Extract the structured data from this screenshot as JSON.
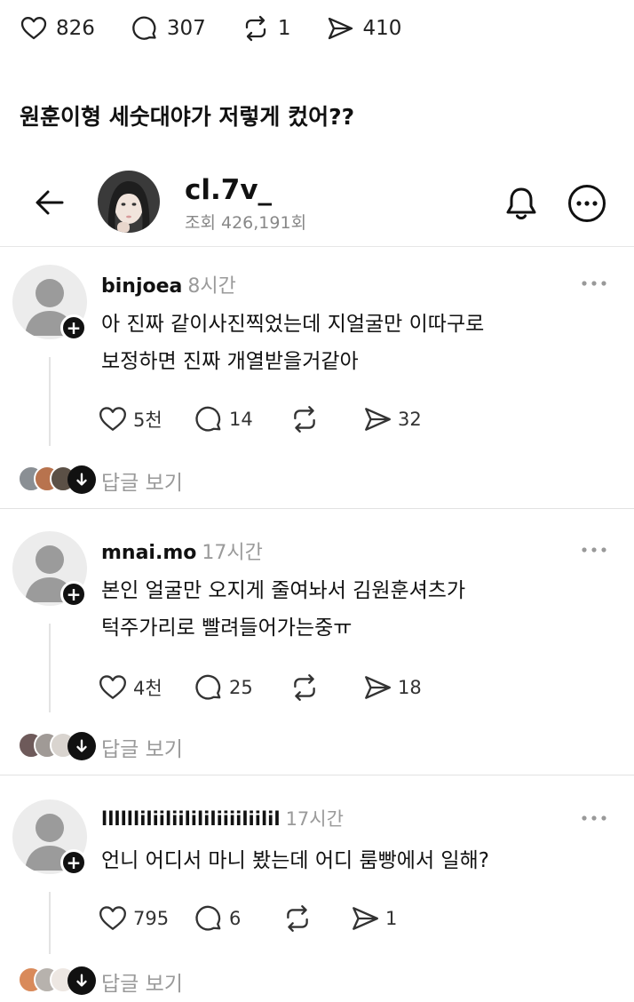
{
  "top_actions": {
    "likes": "826",
    "comments": "307",
    "reposts": "1",
    "shares": "410"
  },
  "caption": "원훈이형 세숫대야가 저렇게 컸어??",
  "header": {
    "username": "cl.7v_",
    "views": "조회 426,191회"
  },
  "comments": [
    {
      "user": "binjoea",
      "time": "8시간",
      "lines": [
        "아 진짜 같이사진찍었는데 지얼굴만 이따구로",
        "보정하면 진짜 개열받을거같아"
      ],
      "likes": "5천",
      "replies": "14",
      "shares": "32",
      "view_replies": "답글 보기"
    },
    {
      "user": "mnai.mo",
      "time": "17시간",
      "lines": [
        "본인 얼굴만 오지게 줄여놔서 김원훈셔츠가",
        "턱주가리로 빨려들어가는중ㅠ"
      ],
      "likes": "4천",
      "replies": "25",
      "shares": "18",
      "view_replies": "답글 보기"
    },
    {
      "user": "lllllliliiliilililiiiiliilil",
      "time": "17시간",
      "lines": [
        "언니 어디서 마니 봤는데 어디 룸빵에서 일해?"
      ],
      "likes": "795",
      "replies": "6",
      "shares": "1",
      "view_replies": "답글 보기"
    }
  ],
  "icons": {
    "like": "heart-icon",
    "comment": "speech-bubble-icon",
    "repost": "repost-arrows-icon",
    "share": "send-icon",
    "back": "arrow-left-icon",
    "notify": "bell-icon",
    "more": "more-horizontal-icon"
  }
}
